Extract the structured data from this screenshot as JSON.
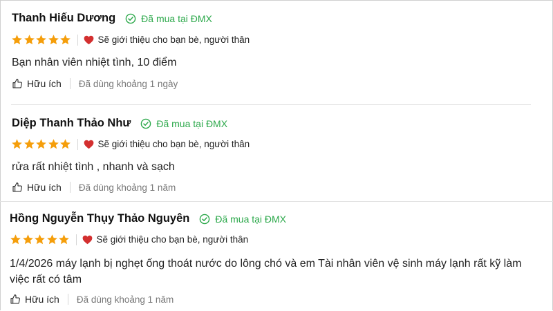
{
  "reviews": [
    {
      "name": "Thanh Hiếu Dương",
      "verified": "Đã mua tại ĐMX",
      "stars": 5,
      "recommend": "Sẽ giới thiệu cho bạn bè, người thân",
      "comment": "Bạn nhân viên nhiệt tình, 10 điểm",
      "helpful": "Hữu ích",
      "used": "Đã dùng khoảng 1 ngày"
    },
    {
      "name": "Diệp Thanh Thảo Như",
      "verified": "Đã mua tại ĐMX",
      "stars": 5,
      "recommend": "Sẽ giới thiệu cho bạn bè, người thân",
      "comment": "rửa rất nhiệt tình , nhanh và sạch",
      "helpful": "Hữu ích",
      "used": "Đã dùng khoảng 1 năm"
    },
    {
      "name": "Hồng Nguyễn Thụy Thảo Nguyên",
      "verified": "Đã mua tại ĐMX",
      "stars": 5,
      "recommend": "Sẽ giới thiệu cho bạn bè, người thân",
      "comment": "1/4/2026 máy lạnh bị nghẹt ống thoát nước do lông chó và em Tài nhân viên vệ sinh máy lạnh rất kỹ làm việc rất có tâm",
      "helpful": "Hữu ích",
      "used": "Đã dùng khoảng 1 năm"
    }
  ],
  "colors": {
    "star": "#f59e0b",
    "verified": "#2ba84a",
    "heart": "#d32f2f"
  },
  "icons": {
    "verified": "check-circle-icon",
    "recommend": "heart-icon",
    "helpful": "thumbs-up-icon",
    "rating": "star-icon"
  }
}
